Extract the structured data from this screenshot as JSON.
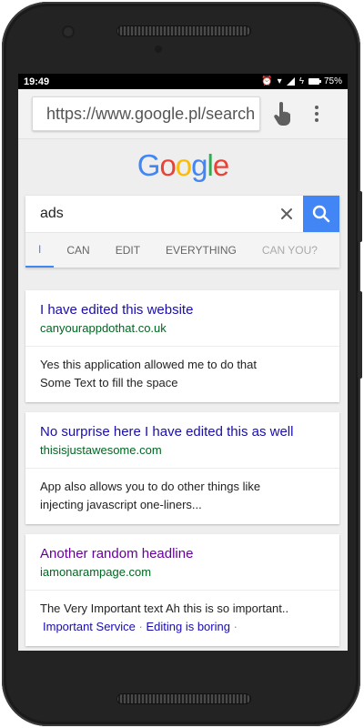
{
  "status": {
    "time": "19:49",
    "battery": "75%"
  },
  "browser": {
    "url": "https://www.google.pl/search"
  },
  "google": {
    "logo": [
      "G",
      "o",
      "o",
      "g",
      "l",
      "e"
    ],
    "logo_colors": [
      "#4285f4",
      "#ea4335",
      "#fbbc05",
      "#4285f4",
      "#34a853",
      "#ea4335"
    ]
  },
  "search": {
    "query": "ads"
  },
  "tabs": [
    "I",
    "CAN",
    "EDIT",
    "EVERYTHING",
    "CAN YOU?"
  ],
  "results": [
    {
      "title": "I have edited this website",
      "url": "canyourappdothat.co.uk",
      "snippet_lines": [
        "Yes this application allowed me to do that",
        "Some Text to fill the space"
      ]
    },
    {
      "title": "No surprise here I have edited this as well",
      "url": "thisisjustawesome.com",
      "snippet_lines": [
        "App also allows you to do other things like",
        "injecting javascript one-liners..."
      ]
    },
    {
      "title": "Another random headline",
      "url": "iamonarampage.com",
      "snippet_lines": [
        "The Very Important text Ah this is so important.."
      ],
      "links": [
        "Important Service",
        "Editing is boring"
      ]
    }
  ],
  "colors": {
    "accent": "#4285f4",
    "link": "#1a0dab",
    "visited": "#660099",
    "url_green": "#006621"
  },
  "icons": [
    "touch-icon",
    "overflow-menu-icon",
    "clear-icon",
    "search-icon"
  ]
}
